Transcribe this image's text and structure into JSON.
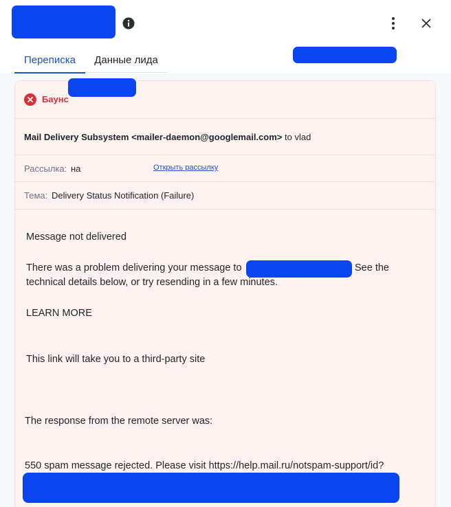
{
  "header": {
    "info_icon": "info-icon",
    "more_icon": "more-vertical-icon",
    "close_icon": "close-icon"
  },
  "tabs": [
    {
      "label": "Переписка",
      "active": true
    },
    {
      "label": "Данные лида",
      "active": false
    }
  ],
  "message": {
    "status": {
      "icon": "error-circle-icon",
      "label": "Баунс",
      "color": "#d6323a"
    },
    "from": {
      "sender": "Mail Delivery Subsystem <mailer-daemon@googlemail.com>",
      "to_prefix": "to vlad"
    },
    "mailing": {
      "label": "Рассылка:",
      "prefix": "на",
      "link_label": "Открыть рассылку"
    },
    "subject": {
      "label": "Тема:",
      "value": "Delivery Status Notification (Failure)"
    },
    "body": {
      "line_1": "Message not delivered",
      "line_2a": "There was a problem delivering your message to",
      "line_2b": "See the",
      "line_3": "technical details below, or try resending in a few minutes.",
      "line_4": "LEARN MORE",
      "line_5": "This link will take you to a third-party site",
      "line_6": "The response from the remote server was:",
      "line_7": "550 spam message rejected. Please visit https://help.mail.ru/notspam-support/id?"
    }
  },
  "colors": {
    "accent": "#1a4fd1",
    "card_bg": "#fff3f2",
    "redaction": "#0a46f0"
  }
}
